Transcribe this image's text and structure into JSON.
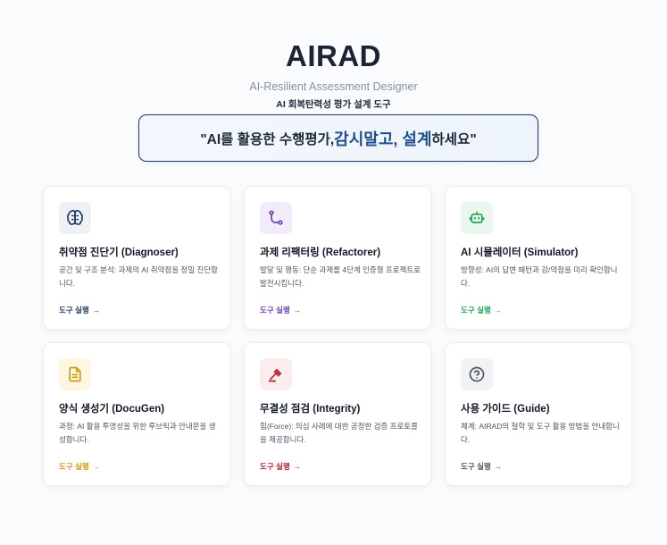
{
  "header": {
    "title": "AIRAD",
    "subtitle": "AI-Resilient Assessment Designer",
    "subtitle_ko": "AI 회복탄력성 평가 설계 도구"
  },
  "slogan": {
    "prefix": "\"AI를 활용한 수행평가, ",
    "highlight": "감시말고, 설계",
    "suffix": "하세요\""
  },
  "cards": [
    {
      "title": "취약점 진단기 (Diagnoser)",
      "desc": "공간 및 구조 분석: 과제의 AI 취약점을 정밀 진단합니다.",
      "link": "도구 실행",
      "arrow": "→",
      "icon": "brain-icon",
      "color": "#1e3a5f",
      "icon_bg": "#eef2f7"
    },
    {
      "title": "과제 리팩터링 (Refactorer)",
      "desc": "발달 및 행동: 단순 과제를 4단계 인증형 프로젝트로 발전시킵니다.",
      "link": "도구 실행",
      "arrow": "→",
      "icon": "git-branch-icon",
      "color": "#6d3fb5",
      "icon_bg": "#f2ecfa"
    },
    {
      "title": "AI 시뮬레이터 (Simulator)",
      "desc": "방향성: AI의 답변 패턴과 강/약점을 미리 확인합니다.",
      "link": "도구 실행",
      "arrow": "→",
      "icon": "robot-icon",
      "color": "#21a355",
      "icon_bg": "#eaf7ef"
    },
    {
      "title": "양식 생성기 (DocuGen)",
      "desc": "과정: AI 활용 투명성을 위한 루브릭과 안내문을 생성합니다.",
      "link": "도구 실행",
      "arrow": "→",
      "icon": "document-icon",
      "color": "#d49a0c",
      "icon_bg": "#fdf6e3"
    },
    {
      "title": "무결성 점검 (Integrity)",
      "desc": "힘(Force): 의심 사례에 대한 공정한 검증 프로토콜을 제공합니다.",
      "link": "도구 실행",
      "arrow": "→",
      "icon": "gavel-icon",
      "color": "#b42335",
      "icon_bg": "#fbecee"
    },
    {
      "title": "사용 가이드 (Guide)",
      "desc": "체계: AIRAD의 철학 및 도구 활용 방법을 안내합니다.",
      "link": "도구 실행",
      "arrow": "→",
      "icon": "help-circle-icon",
      "color": "#4b5563",
      "icon_bg": "#f1f2f4"
    }
  ]
}
